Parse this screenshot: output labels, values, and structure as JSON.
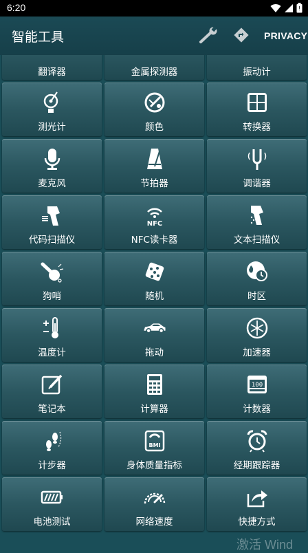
{
  "status": {
    "time": "6:20"
  },
  "app": {
    "title": "智能工具",
    "privacy_label": "PRIVACY"
  },
  "tiles": [
    {
      "label": "翻译器",
      "icon": "translator-icon"
    },
    {
      "label": "金属探测器",
      "icon": "metal-detector-icon"
    },
    {
      "label": "振动计",
      "icon": "vibrometer-icon"
    },
    {
      "label": "测光计",
      "icon": "light-meter-icon"
    },
    {
      "label": "颜色",
      "icon": "color-icon"
    },
    {
      "label": "转换器",
      "icon": "converter-icon"
    },
    {
      "label": "麦克风",
      "icon": "microphone-icon"
    },
    {
      "label": "节拍器",
      "icon": "metronome-icon"
    },
    {
      "label": "调谐器",
      "icon": "tuning-fork-icon"
    },
    {
      "label": "代码扫描仪",
      "icon": "barcode-scanner-icon"
    },
    {
      "label": "NFC读卡器",
      "icon": "nfc-icon"
    },
    {
      "label": "文本扫描仪",
      "icon": "text-scanner-icon"
    },
    {
      "label": "狗哨",
      "icon": "dog-whistle-icon"
    },
    {
      "label": "随机",
      "icon": "dice-icon"
    },
    {
      "label": "时区",
      "icon": "timezone-icon"
    },
    {
      "label": "温度计",
      "icon": "thermometer-icon"
    },
    {
      "label": "拖动",
      "icon": "car-icon"
    },
    {
      "label": "加速器",
      "icon": "accelerometer-icon"
    },
    {
      "label": "笔记本",
      "icon": "notebook-icon"
    },
    {
      "label": "计算器",
      "icon": "calculator-icon"
    },
    {
      "label": "计数器",
      "icon": "counter-icon"
    },
    {
      "label": "计步器",
      "icon": "footsteps-icon"
    },
    {
      "label": "身体质量指标",
      "icon": "bmi-icon"
    },
    {
      "label": "经期跟踪器",
      "icon": "alarm-clock-icon"
    },
    {
      "label": "电池测试",
      "icon": "battery-icon"
    },
    {
      "label": "网络速度",
      "icon": "speedometer-icon"
    },
    {
      "label": "快捷方式",
      "icon": "share-icon"
    }
  ],
  "watermark": "激活 Wind"
}
